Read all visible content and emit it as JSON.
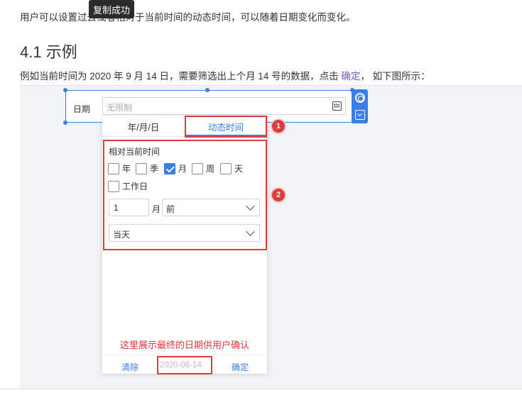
{
  "intro_text": "用户可以设置过去或者相对于当前时间的动态时间，可以随着日期变化而变化。",
  "tooltip": "复制成功",
  "heading": "4.1 示例",
  "example": {
    "before": "例如当前时间为 2020 年 9 月 14 日，需要筛选出上个月 14 号的数据，点击 ",
    "link": "确定",
    "after": "， 如下图所示："
  },
  "widget": {
    "label": "日期",
    "placeholder": "无限制",
    "icons": [
      "calendar-icon",
      "gear-icon",
      "dropdown-icon"
    ]
  },
  "panel": {
    "tabs": [
      "年/月/日",
      "动态时间"
    ],
    "active_tab": 1,
    "section_title": "相对当前时间",
    "units": [
      {
        "label": "年",
        "checked": false
      },
      {
        "label": "季",
        "checked": false
      },
      {
        "label": "月",
        "checked": true
      },
      {
        "label": "周",
        "checked": false
      },
      {
        "label": "天",
        "checked": false
      },
      {
        "label": "工作日",
        "checked": false
      }
    ],
    "offset_value": "1",
    "offset_unit": "月",
    "direction": "前",
    "anchor": "当天",
    "note": "这里展示最终的日期供用户确认",
    "clear_label": "清除",
    "result_date": "2020-08-14",
    "confirm_label": "确定"
  },
  "markers": [
    "1",
    "2"
  ],
  "colors": {
    "accent": "#3b7ee8",
    "annotation": "#e03b3b",
    "link": "#7b56c9"
  }
}
